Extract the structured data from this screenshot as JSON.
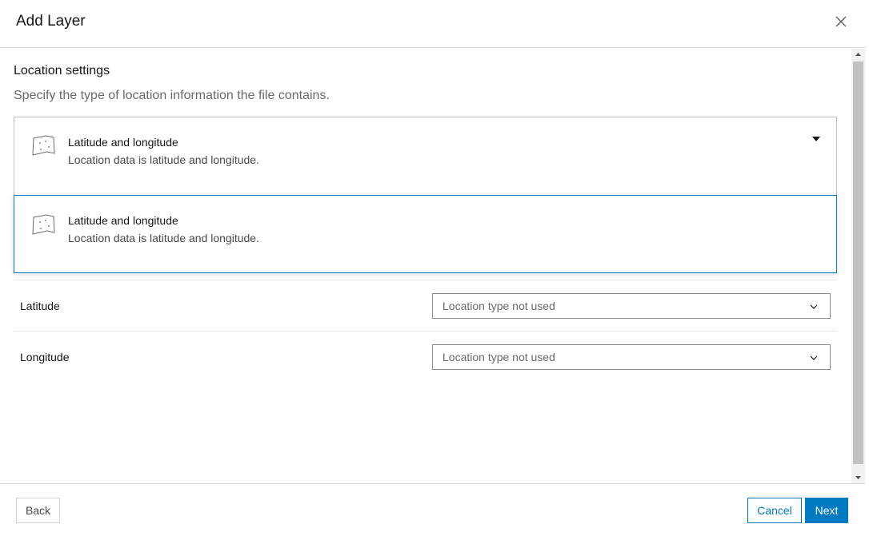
{
  "dialog": {
    "title": "Add Layer",
    "close_icon": "close-icon"
  },
  "location": {
    "section_title": "Location settings",
    "description": "Specify the type of location information the file contains.",
    "selected": {
      "icon": "map-points-icon",
      "title": "Latitude and longitude",
      "description": "Location data is latitude and longitude."
    },
    "options": [
      {
        "icon": "map-points-icon",
        "title": "Latitude and longitude",
        "description": "Location data is latitude and longitude."
      }
    ]
  },
  "fields": [
    {
      "label": "Latitude",
      "value": "Location type not used"
    },
    {
      "label": "Longitude",
      "value": "Location type not used"
    }
  ],
  "footer": {
    "back_label": "Back",
    "cancel_label": "Cancel",
    "next_label": "Next"
  },
  "colors": {
    "accent": "#007ac2",
    "border": "#bfbfbf",
    "muted_text": "#6a6a6a"
  }
}
